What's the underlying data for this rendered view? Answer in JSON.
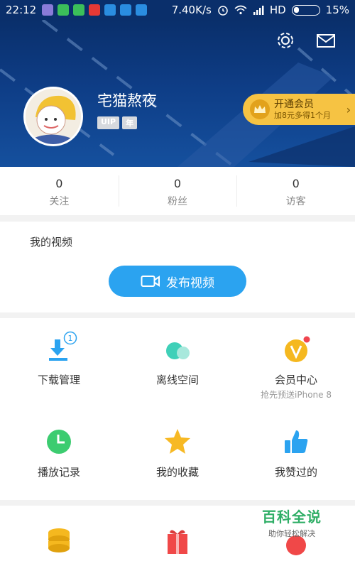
{
  "status_bar": {
    "time": "22:12",
    "network_speed": "7.40K/s",
    "network_type": "HD",
    "battery": "15%"
  },
  "profile": {
    "username": "宅猫熬夜",
    "badges": [
      "UIP",
      "年"
    ],
    "vip_title": "开通会员",
    "vip_subtitle": "加8元多得1个月"
  },
  "stats": [
    {
      "value": "0",
      "label": "关注"
    },
    {
      "value": "0",
      "label": "粉丝"
    },
    {
      "value": "0",
      "label": "访客"
    }
  ],
  "videos": {
    "title": "我的视频",
    "publish_label": "发布视频"
  },
  "grid": [
    {
      "label": "下载管理",
      "sub": "",
      "icon": "download-icon",
      "badge": "1"
    },
    {
      "label": "离线空间",
      "sub": "",
      "icon": "cloud-icon"
    },
    {
      "label": "会员中心",
      "sub": "抢先预送iPhone 8",
      "icon": "vip-icon"
    },
    {
      "label": "播放记录",
      "sub": "",
      "icon": "clock-icon"
    },
    {
      "label": "我的收藏",
      "sub": "",
      "icon": "star-icon"
    },
    {
      "label": "我赞过的",
      "sub": "",
      "icon": "thumbs-up-icon"
    }
  ],
  "watermark": {
    "title": "百科全说",
    "subtitle": "助你轻松解决"
  },
  "colors": {
    "header_dark": "#0a2f6b",
    "accent_blue": "#2ba3f0",
    "vip_gold": "#f6c343",
    "green": "#3ccc70"
  }
}
